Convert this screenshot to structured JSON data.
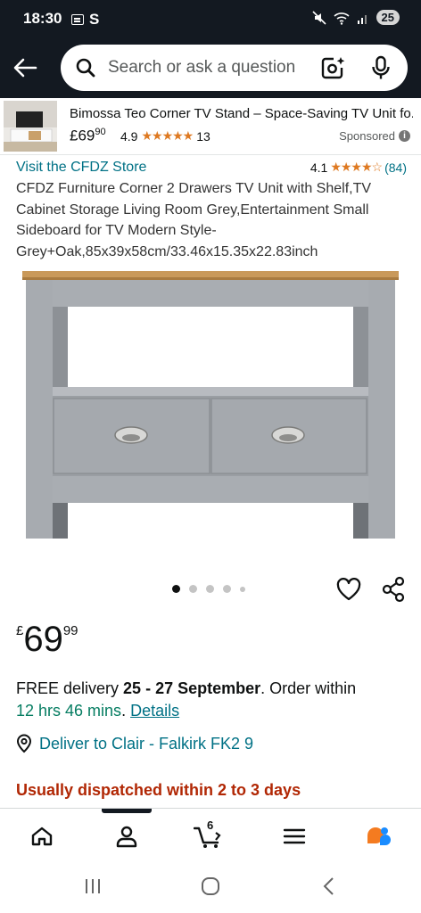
{
  "status_bar": {
    "time": "18:30",
    "carrier_glyph": "S",
    "battery": "25",
    "icons": [
      "gallery-icon",
      "mute-icon",
      "wifi-icon",
      "signal-icon"
    ]
  },
  "search": {
    "placeholder": "Search or ask a question"
  },
  "sponsored_ad": {
    "title": "Bimossa Teo Corner TV Stand – Space-Saving TV Unit fo...",
    "price_whole": "£69",
    "price_fraction": "90",
    "rating": "4.9",
    "stars": "★★★★★",
    "review_count": "13",
    "label": "Sponsored"
  },
  "product": {
    "store_link": "Visit the CFDZ Store",
    "rating": "4.1",
    "stars": "★★★★☆",
    "review_count": "(84)",
    "title": "CFDZ Furniture Corner 2 Drawers TV Unit with Shelf,TV Cabinet Storage Living Room Grey,Entertainment Small Sideboard for TV Modern Style-Grey+Oak,85x39x58cm/33.46x15.35x22.83inch",
    "image_count": 5,
    "active_image": 0,
    "price": {
      "currency": "£",
      "whole": "69",
      "fraction": "99"
    }
  },
  "delivery": {
    "prefix": "FREE delivery ",
    "dates": "25 - 27 September",
    "mid": ". Order within",
    "countdown": "12 hrs 46 mins",
    "dot": ". ",
    "details_link": "Details"
  },
  "deliver_to": "Deliver to Clair - Falkirk FK2 9",
  "dispatch": "Usually dispatched within 2 to 3 days",
  "bottom_nav": {
    "cart_count": "6",
    "items": [
      "home-icon",
      "account-icon",
      "cart-icon",
      "menu-icon",
      "rufus-icon"
    ],
    "active": 1
  },
  "colors": {
    "header_bg": "#131921",
    "link": "#007185",
    "star": "#de7921",
    "dispatch_red": "#b12704",
    "countdown_green": "#067d62"
  }
}
